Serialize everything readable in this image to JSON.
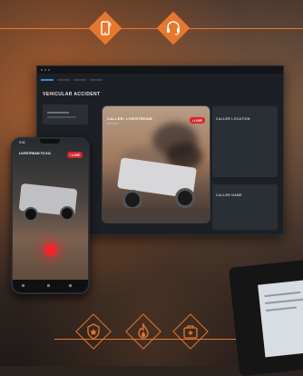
{
  "colors": {
    "accent": "#e8772e",
    "live_red": "#d9262b",
    "nav_active": "#3d8bd8"
  },
  "top_icons": [
    "smartphone-icon",
    "headset-icon"
  ],
  "bottom_icons": [
    "police-badge-icon",
    "fire-icon",
    "medical-kit-icon"
  ],
  "dashboard": {
    "title": "VEHICULAR ACCIDENT",
    "video": {
      "caller_label": "CALLER: LIVESTREAM",
      "caller_sub": "00:00:00",
      "live_badge": "• LIVE"
    },
    "panels": {
      "caller_location": "CALLER LOCATION",
      "caller_name": "CALLER NAME"
    }
  },
  "phone": {
    "time": "9:41",
    "caption": "LIVESTREAM TO 911",
    "live_badge": "• LIVE"
  }
}
